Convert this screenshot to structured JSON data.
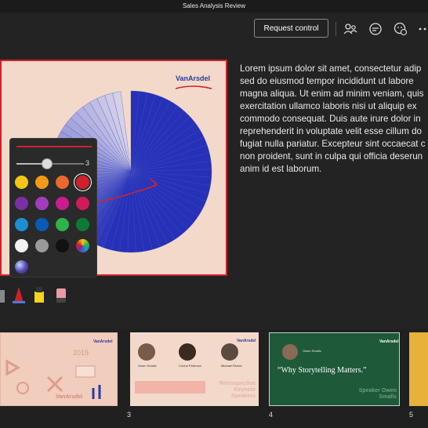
{
  "window": {
    "title": "Sales Analysis Review"
  },
  "toolbar": {
    "request_control_label": "Request control"
  },
  "slide": {
    "brand": "VanArsdel"
  },
  "notes": {
    "lines": [
      "Lorem ipsum dolor sit amet, consectetur adip",
      "sed do eiusmod tempor incididunt ut labore",
      "magna aliqua. Ut enim ad minim veniam, quis",
      "exercitation ullamco laboris nisi ut aliquip ex",
      "commodo consequat. Duis aute irure dolor in",
      "reprehenderit in voluptate velit esse cillum do",
      "fugiat nulla pariatur. Excepteur sint occaecat c",
      "non proident, sunt in culpa qui officia deserun",
      "anim id est laborum."
    ]
  },
  "pen_palette": {
    "size_value": "3",
    "size_fraction": 0.45,
    "swatches": [
      "#f5c518",
      "#f29a13",
      "#e8692e",
      "#d2202b",
      "#7b2fa5",
      "#a43bbf",
      "#c81c8f",
      "#d11a5a",
      "#1a8fd6",
      "#0a5bb5",
      "#2db34a",
      "#0f7a35",
      "#f2f2f2",
      "#9a9a9a",
      "#111111",
      "rainbow",
      "galaxy"
    ],
    "selected_index": 3
  },
  "thumbnails": {
    "slides": [
      {
        "number": "",
        "brand": "VanArsdel",
        "year": "2019",
        "footer": "VanArsdel"
      },
      {
        "number": "3",
        "brand": "VanArsdel",
        "people": [
          "Owen Smalls",
          "Corina Peterson",
          "Michael Rivera"
        ],
        "title": "Retrospective Keynote Speakers"
      },
      {
        "number": "4",
        "brand": "VanArsdel",
        "person": "Owen Smalls",
        "quote": "“Why Storytelling Matters.”",
        "footer": "Speaker Owen Smalls"
      },
      {
        "number": "5"
      }
    ]
  },
  "colors": {
    "accent_red": "#d2202b",
    "slide_bg": "#f3d9c9",
    "pie_blue": "#2631b8",
    "green_slide": "#1e5a3a"
  }
}
